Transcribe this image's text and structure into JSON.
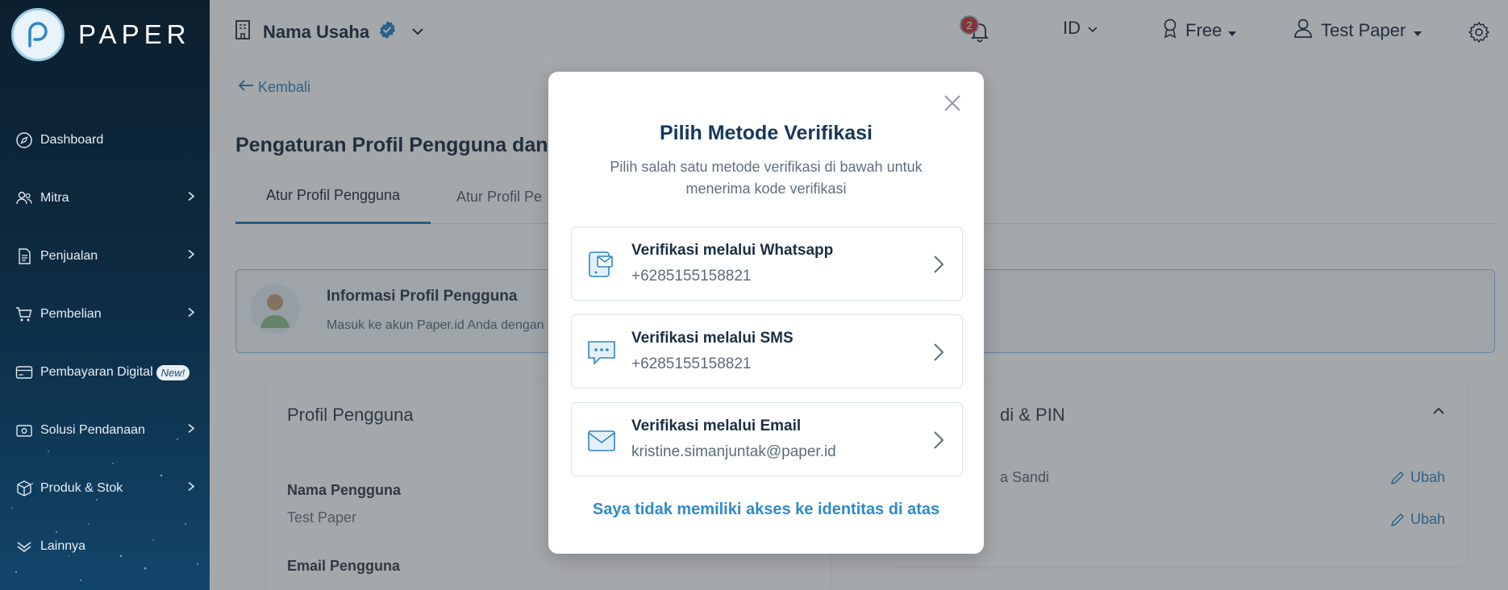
{
  "sidebar": {
    "brand": "PAPER",
    "items": [
      {
        "label": "Dashboard",
        "icon": "compass-icon",
        "has_chevron": false
      },
      {
        "label": "Mitra",
        "icon": "users-icon",
        "has_chevron": true
      },
      {
        "label": "Penjualan",
        "icon": "document-icon",
        "has_chevron": true
      },
      {
        "label": "Pembelian",
        "icon": "cart-icon",
        "has_chevron": true
      },
      {
        "label": "Pembayaran Digital",
        "icon": "card-icon",
        "has_chevron": false,
        "badge": "New!"
      },
      {
        "label": "Solusi Pendanaan",
        "icon": "money-icon",
        "has_chevron": true
      },
      {
        "label": "Produk & Stok",
        "icon": "box-icon",
        "has_chevron": true
      },
      {
        "label": "Lainnya",
        "icon": "layers-icon",
        "has_chevron": false
      }
    ]
  },
  "header": {
    "business_name": "Nama Usaha",
    "notification_count": "2",
    "language": "ID",
    "plan": "Free",
    "user": "Test Paper"
  },
  "main": {
    "back_label": "Kembali",
    "page_title": "Pengaturan Profil Pengguna dan P",
    "tabs": [
      {
        "label": "Atur Profil Pengguna",
        "active": true
      },
      {
        "label": "Atur Profil Pe",
        "active": false
      }
    ],
    "info_title": "Informasi Profil Pengguna",
    "info_desc": "Masuk ke akun Paper.id Anda dengan m",
    "profile_card_title": "Profil Pengguna",
    "fields": [
      {
        "label": "Nama Pengguna",
        "value": "Test Paper"
      },
      {
        "label": "Email Pengguna",
        "value": ""
      }
    ],
    "security_card_title": "di & PIN",
    "security_rows": [
      {
        "label": "a Sandi",
        "action": "Ubah"
      },
      {
        "label": "",
        "action": "Ubah"
      }
    ]
  },
  "modal": {
    "title": "Pilih Metode Verifikasi",
    "subtitle": "Pilih salah satu metode verifikasi di bawah untuk menerima kode verifikasi",
    "options": [
      {
        "title": "Verifikasi melalui Whatsapp",
        "value": "+6285155158821",
        "icon": "whatsapp-message-icon"
      },
      {
        "title": "Verifikasi melalui SMS",
        "value": "+6285155158821",
        "icon": "sms-chat-icon"
      },
      {
        "title": "Verifikasi melalui Email",
        "value": "kristine.simanjuntak@paper.id",
        "icon": "email-icon"
      }
    ],
    "no_access_link": "Saya tidak memiliki akses ke identitas di atas"
  },
  "colors": {
    "sidebar_top": "#0c1f2e",
    "sidebar_bottom": "#12456b",
    "accent": "#2f8ac9",
    "modal_title": "#16375a",
    "notification": "#c43a3a"
  }
}
